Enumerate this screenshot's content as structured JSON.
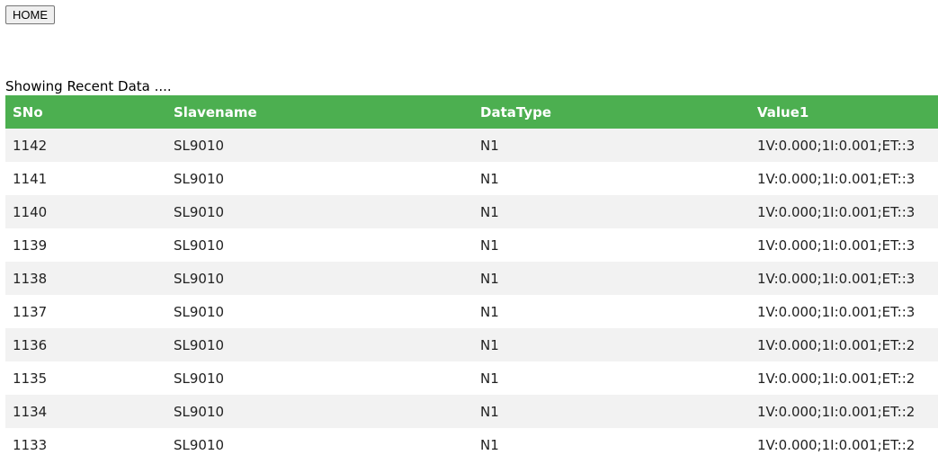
{
  "toolbar": {
    "home_label": "HOME"
  },
  "status_text": "Showing Recent Data ....",
  "table": {
    "header_color": "#4caf50",
    "columns": [
      "SNo",
      "Slavename",
      "DataType",
      "Value1"
    ],
    "rows": [
      [
        "1142",
        "SL9010",
        "N1",
        "1V:0.000;1I:0.001;ET::3"
      ],
      [
        "1141",
        "SL9010",
        "N1",
        "1V:0.000;1I:0.001;ET::3"
      ],
      [
        "1140",
        "SL9010",
        "N1",
        "1V:0.000;1I:0.001;ET::3"
      ],
      [
        "1139",
        "SL9010",
        "N1",
        "1V:0.000;1I:0.001;ET::3"
      ],
      [
        "1138",
        "SL9010",
        "N1",
        "1V:0.000;1I:0.001;ET::3"
      ],
      [
        "1137",
        "SL9010",
        "N1",
        "1V:0.000;1I:0.001;ET::3"
      ],
      [
        "1136",
        "SL9010",
        "N1",
        "1V:0.000;1I:0.001;ET::2"
      ],
      [
        "1135",
        "SL9010",
        "N1",
        "1V:0.000;1I:0.001;ET::2"
      ],
      [
        "1134",
        "SL9010",
        "N1",
        "1V:0.000;1I:0.001;ET::2"
      ],
      [
        "1133",
        "SL9010",
        "N1",
        "1V:0.000;1I:0.001;ET::2"
      ]
    ]
  }
}
